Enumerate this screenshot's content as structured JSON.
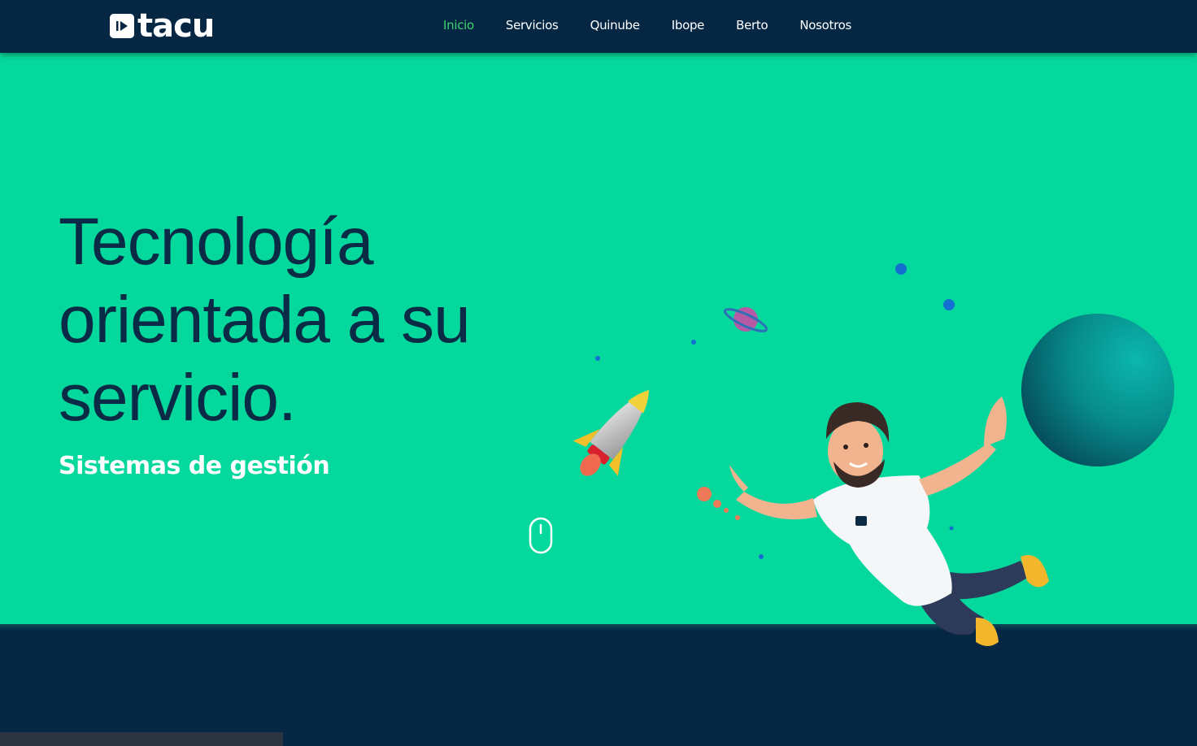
{
  "brand": {
    "name": "tacu",
    "logo_icon": "play-square-icon"
  },
  "nav": {
    "items": [
      {
        "label": "Inicio",
        "active": true
      },
      {
        "label": "Servicios",
        "active": false
      },
      {
        "label": "Quinube",
        "active": false
      },
      {
        "label": "Ibope",
        "active": false
      },
      {
        "label": "Berto",
        "active": false
      },
      {
        "label": "Nosotros",
        "active": false
      }
    ]
  },
  "hero": {
    "line1": "Tecnología",
    "line2": "orientada a su",
    "line3": "servicio.",
    "subtitle": "Sistemas de gestión",
    "scroll_icon": "mouse-scroll-icon"
  },
  "colors": {
    "navy": "#052744",
    "hero_green": "#04d89c",
    "active_link": "#3fd36f",
    "headline": "#0a2b45"
  }
}
